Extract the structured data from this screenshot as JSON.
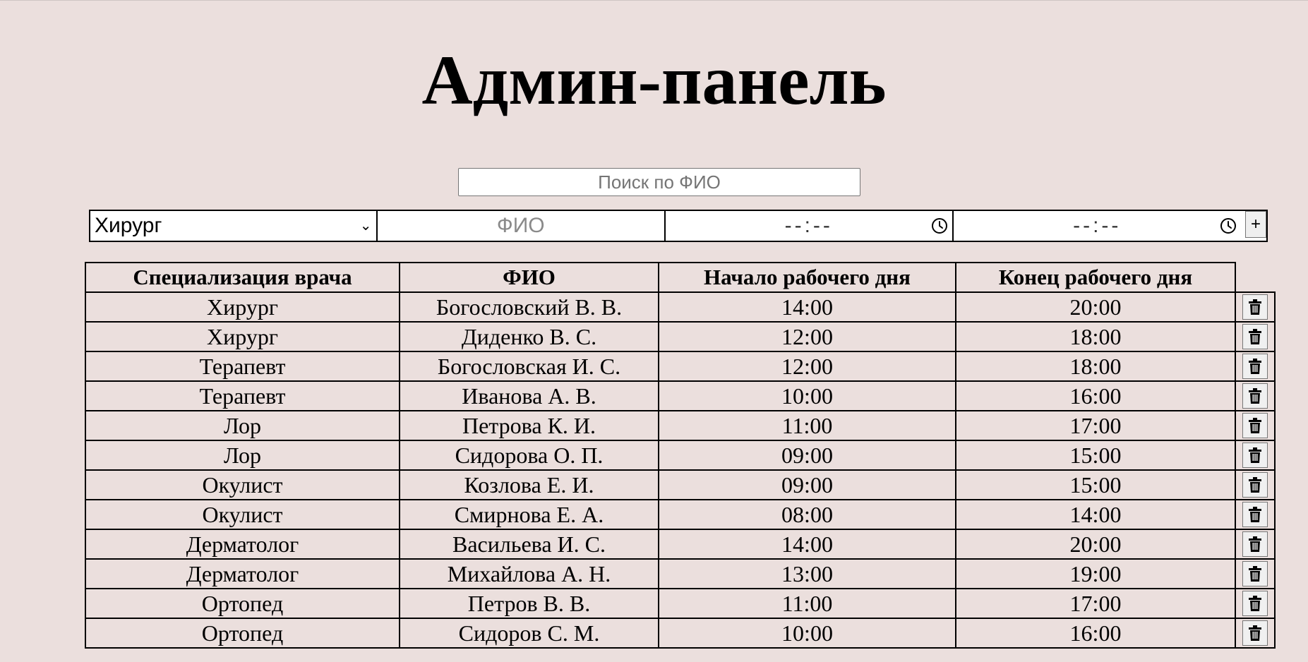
{
  "header": {
    "title": "Админ-панель"
  },
  "search": {
    "placeholder": "Поиск по ФИО"
  },
  "form": {
    "specialization_selected": "Хирург",
    "fio_placeholder": "ФИО",
    "start_time_placeholder": "--:--",
    "end_time_placeholder": "--:--",
    "add_label": "+"
  },
  "table": {
    "headers": [
      "Специализация врача",
      "ФИО",
      "Начало рабочего дня",
      "Конец рабочего дня"
    ],
    "rows": [
      [
        "Хирург",
        "Богословский В. В.",
        "14:00",
        "20:00"
      ],
      [
        "Хирург",
        "Диденко В. С.",
        "12:00",
        "18:00"
      ],
      [
        "Терапевт",
        "Богословская И. С.",
        "12:00",
        "18:00"
      ],
      [
        "Терапевт",
        "Иванова А. В.",
        "10:00",
        "16:00"
      ],
      [
        "Лор",
        "Петрова К. И.",
        "11:00",
        "17:00"
      ],
      [
        "Лор",
        "Сидорова О. П.",
        "09:00",
        "15:00"
      ],
      [
        "Окулист",
        "Козлова Е. И.",
        "09:00",
        "15:00"
      ],
      [
        "Окулист",
        "Смирнова Е. А.",
        "08:00",
        "14:00"
      ],
      [
        "Дерматолог",
        "Васильева И. С.",
        "14:00",
        "20:00"
      ],
      [
        "Дерматолог",
        "Михайлова А. Н.",
        "13:00",
        "19:00"
      ],
      [
        "Ортопед",
        "Петров В. В.",
        "11:00",
        "17:00"
      ],
      [
        "Ортопед",
        "Сидоров С. М.",
        "10:00",
        "16:00"
      ]
    ],
    "row_action_icon": "trash-icon"
  },
  "colors": {
    "background": "#ebdfdd"
  }
}
